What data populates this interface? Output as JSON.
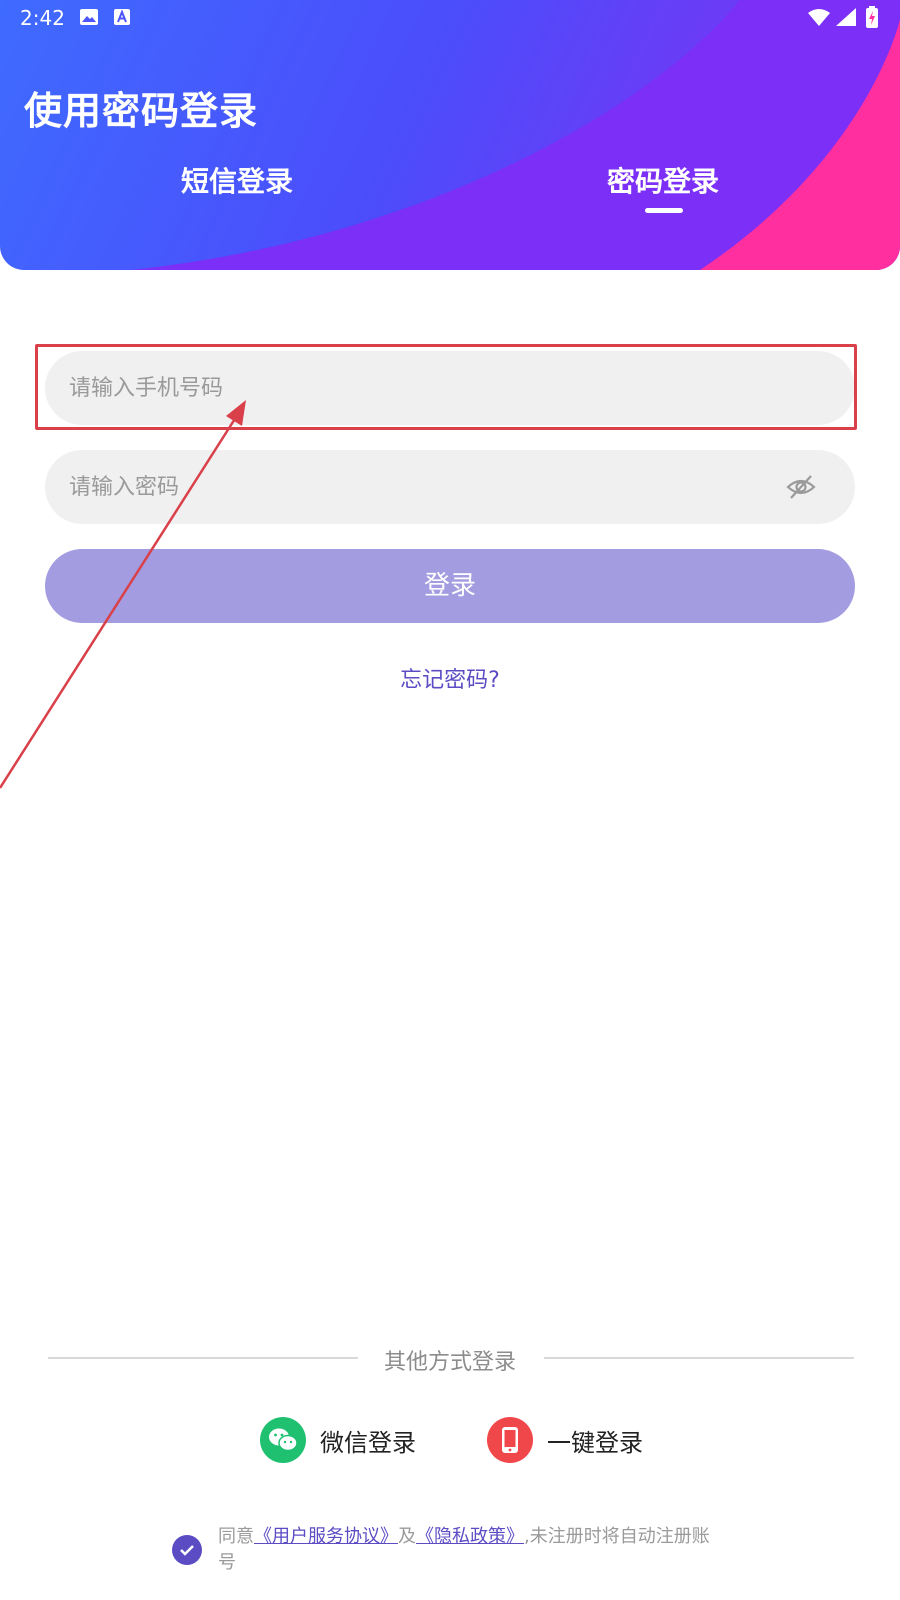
{
  "status_bar": {
    "time": "2:42",
    "icons": [
      "image-icon",
      "a-box-icon",
      "wifi-icon",
      "signal-icon",
      "battery-charging-icon"
    ]
  },
  "header": {
    "title": "使用密码登录",
    "tabs": [
      {
        "label": "短信登录",
        "active": false
      },
      {
        "label": "密码登录",
        "active": true
      }
    ]
  },
  "form": {
    "phone_placeholder": "请输入手机号码",
    "password_placeholder": "请输入密码",
    "login_label": "登录",
    "forgot_label": "忘记密码?"
  },
  "other_login": {
    "title": "其他方式登录",
    "methods": [
      {
        "label": "微信登录",
        "icon": "wechat-icon",
        "color": "#1fc171"
      },
      {
        "label": "一键登录",
        "icon": "phone-icon",
        "color": "#f0474a"
      }
    ]
  },
  "agreement": {
    "prefix": "同意",
    "user_agreement": "《用户服务协议》",
    "and": "及",
    "privacy_policy": "《隐私政策》",
    "suffix": ",未注册时将自动注册账号"
  },
  "colors": {
    "accent": "#5b4cc4",
    "button": "#a49ce0",
    "header_blue": "#3f6bff",
    "header_purple": "#7b2ff7",
    "header_pink": "#ff2fa0",
    "annotation_red": "#d9404a"
  }
}
